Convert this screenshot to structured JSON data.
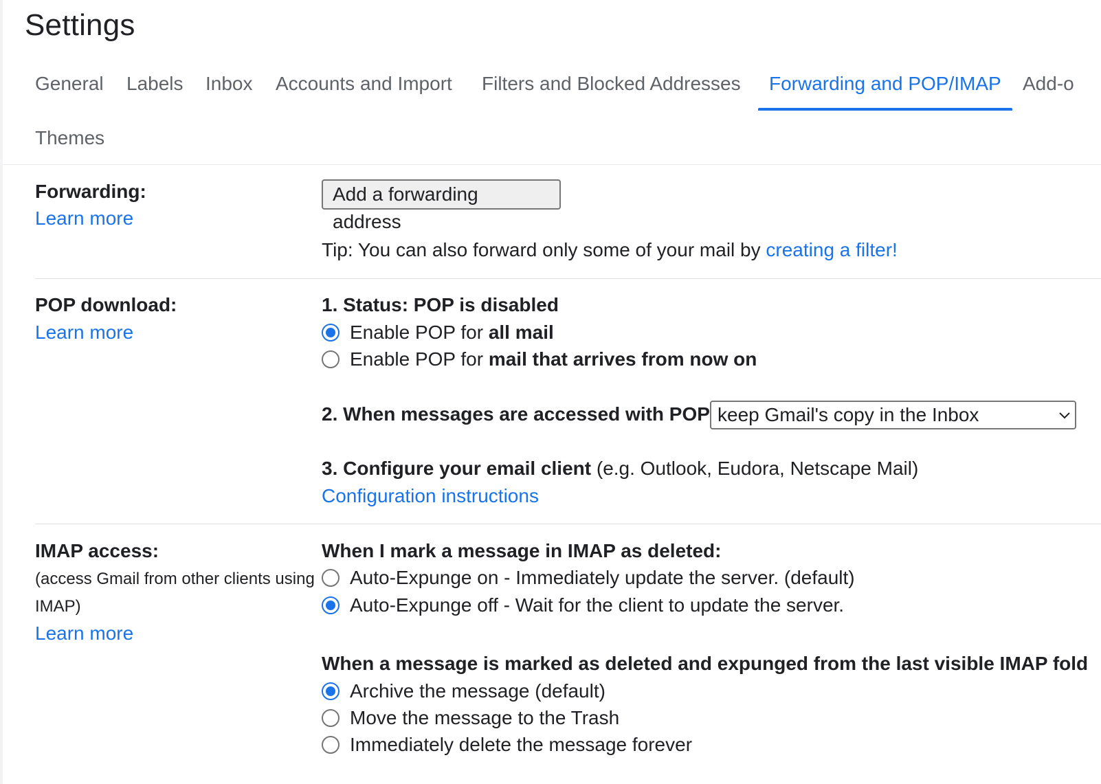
{
  "header": {
    "title": "Settings"
  },
  "tabs": [
    {
      "label": "General"
    },
    {
      "label": "Labels"
    },
    {
      "label": "Inbox"
    },
    {
      "label": "Accounts and Import"
    },
    {
      "label": "Filters and Blocked Addresses"
    },
    {
      "label": "Forwarding and POP/IMAP",
      "active": true
    },
    {
      "label": "Add-o"
    },
    {
      "label": "Themes"
    }
  ],
  "forwarding": {
    "label": "Forwarding:",
    "learn_more": "Learn more",
    "add_button": "Add a forwarding address",
    "tip_text": "Tip: You can also forward only some of your mail by ",
    "tip_link": "creating a filter!"
  },
  "pop": {
    "label": "POP download:",
    "learn_more": "Learn more",
    "status": "1. Status: POP is disabled",
    "options": [
      {
        "prefix": "Enable POP for ",
        "bold": "all mail",
        "selected": true
      },
      {
        "prefix": "Enable POP for ",
        "bold": "mail that arrives from now on",
        "selected": false
      }
    ],
    "access_label": "2. When messages are accessed with POP",
    "access_value": "keep Gmail's copy in the Inbox",
    "configure_bold": "3. Configure your email client",
    "configure_rest": " (e.g. Outlook, Eudora, Netscape Mail)",
    "config_link": "Configuration instructions"
  },
  "imap": {
    "label": "IMAP access:",
    "description_line1": "(access Gmail from other clients using",
    "description_line2": "IMAP)",
    "learn_more": "Learn more",
    "deleted_heading": "When I mark a message in IMAP as deleted:",
    "deleted_options": [
      {
        "label": "Auto-Expunge on - Immediately update the server. (default)",
        "selected": false
      },
      {
        "label": "Auto-Expunge off - Wait for the client to update the server.",
        "selected": true
      }
    ],
    "expunged_heading": "When a message is marked as deleted and expunged from the last visible IMAP fold",
    "expunged_options": [
      {
        "label": "Archive the message (default)",
        "selected": true
      },
      {
        "label": "Move the message to the Trash",
        "selected": false
      },
      {
        "label": "Immediately delete the message forever",
        "selected": false
      }
    ]
  },
  "colors": {
    "accent": "#1a73e8",
    "text": "#202124",
    "tab_text": "#5f6368"
  }
}
